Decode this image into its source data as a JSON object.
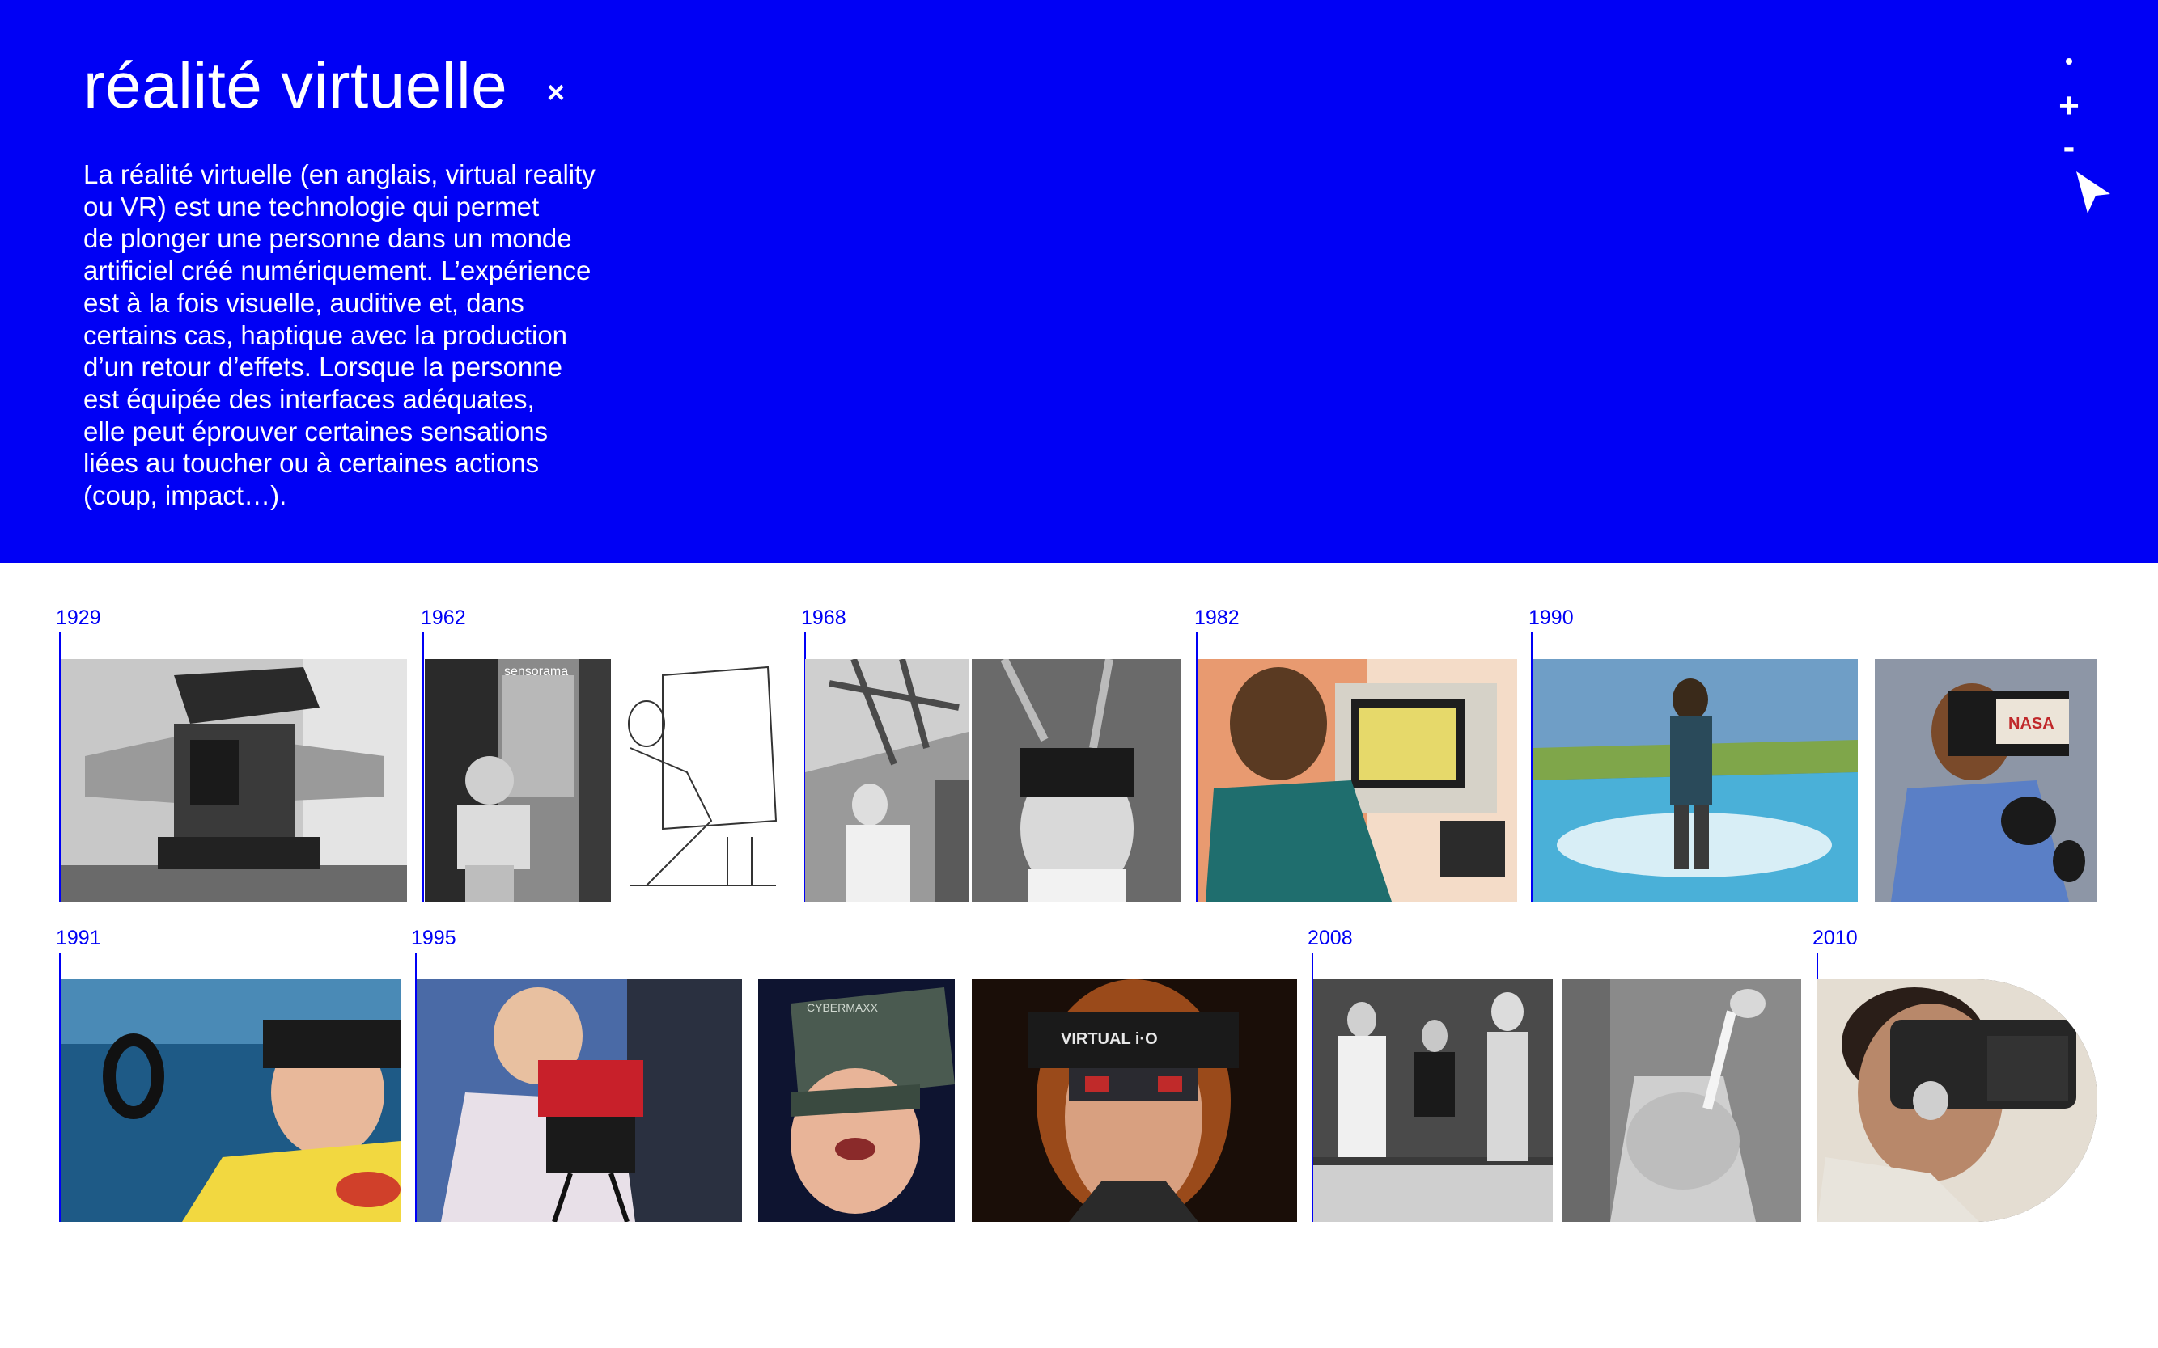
{
  "hero": {
    "title": "réalité virtuelle",
    "close_symbol": "×",
    "description": "La réalité virtuelle (en anglais, virtual reality\nou VR) est une technologie qui permet\nde plonger une personne dans un monde\nartificiel créé numériquement. L’expérience\nest à la fois visuelle, auditive et, dans\ncertains cas, haptique avec la production\nd’un retour d’effets. Lorsque la personne\nest équipée des interfaces adéquates,\nelle peut éprouver certaines sensations\nliées au toucher ou à certaines actions\n(coup, impact…).",
    "accent_color": "#0000f5"
  },
  "controls": {
    "plus": "+",
    "minus": "-",
    "icons": [
      "dot-icon",
      "plus-icon",
      "minus-icon",
      "cursor-icon"
    ]
  },
  "timeline": {
    "years": [
      "1929",
      "1962",
      "1968",
      "1982",
      "1990",
      "1991",
      "1995",
      "2008",
      "2010"
    ],
    "photo_labels": {
      "sensorama": "sensorama",
      "nasa": "NASA",
      "cybermaxx": "CYBERMAXX",
      "virtual_io": "VIRTUAL i·O"
    }
  }
}
